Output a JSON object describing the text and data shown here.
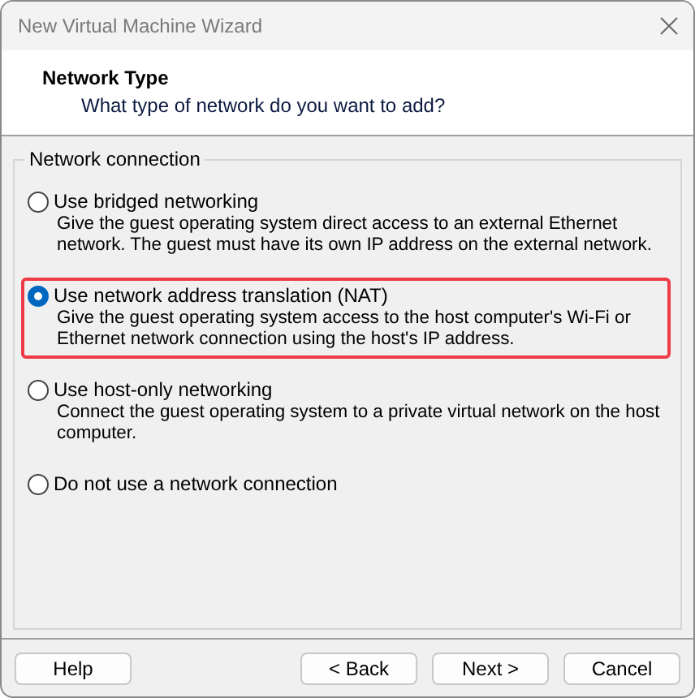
{
  "window": {
    "title": "New Virtual Machine Wizard"
  },
  "header": {
    "title": "Network Type",
    "subtitle": "What type of network do you want to add?"
  },
  "group": {
    "label": "Network connection",
    "options": [
      {
        "label": "Use bridged networking",
        "description": "Give the guest operating system direct access to an external Ethernet network. The guest must have its own IP address on the external network.",
        "selected": false,
        "highlighted": false
      },
      {
        "label": "Use network address translation (NAT)",
        "description": "Give the guest operating system access to the host computer's Wi-Fi or Ethernet network connection using the host's IP address.",
        "selected": true,
        "highlighted": true
      },
      {
        "label": "Use host-only networking",
        "description": "Connect the guest operating system to a private virtual network on the host computer.",
        "selected": false,
        "highlighted": false
      },
      {
        "label": "Do not use a network connection",
        "selected": false,
        "highlighted": false
      }
    ]
  },
  "buttons": {
    "help": "Help",
    "back": "< Back",
    "next": "Next >",
    "cancel": "Cancel"
  }
}
